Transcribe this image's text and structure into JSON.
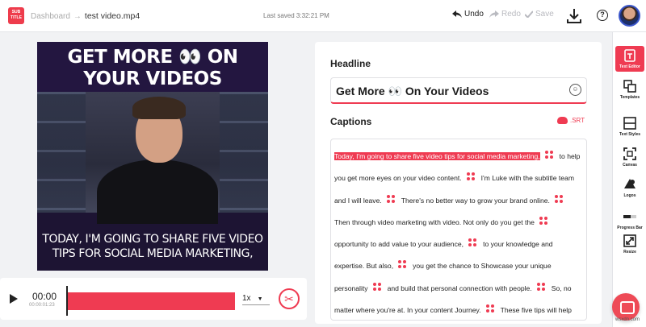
{
  "topbar": {
    "logo_text": "SUB TITLE",
    "breadcrumb_parent": "Dashboard",
    "breadcrumb_arrow": "→",
    "file_name": "test video.mp4",
    "last_saved": "Last saved 3:32:21 PM",
    "undo": "Undo",
    "redo": "Redo",
    "save": "Save",
    "help": "?"
  },
  "video": {
    "headline_line1": "GET MORE 👀 ON",
    "headline_line2": "YOUR VIDEOS",
    "caption_line1": "TODAY, I'M GOING TO SHARE FIVE VIDEO",
    "caption_line2": "TIPS FOR SOCIAL MEDIA MARKETING,"
  },
  "player": {
    "current_time": "00:00",
    "duration": "00:00:01:23",
    "speed": "1x",
    "progress": 0
  },
  "editor": {
    "headline_label": "Headline",
    "headline_value": "Get More 👀 On Your Videos",
    "captions_label": "Captions",
    "srt_label": ".SRT",
    "captions": [
      "Today, I'm going to share five video tips for social media marketing,",
      "to help you get more eyes on your video content.",
      "I'm Luke with the subtitle team and I will leave.",
      "There's no better way to grow your brand online.",
      "Then through video marketing with video. Not only do you get the",
      "opportunity to add value to your audience,",
      "to your knowledge and expertise. But also,",
      "you get the chance to Showcase your unique personality",
      "and build that personal connection with people.",
      "So, no matter where you're at. In your content Journey.",
      "These five tips will help"
    ]
  },
  "sidebar": {
    "items": [
      {
        "label": "Text Editor",
        "icon": "text-editor-icon"
      },
      {
        "label": "Templates",
        "icon": "templates-icon"
      },
      {
        "label": "Text Styles",
        "icon": "text-styles-icon"
      },
      {
        "label": "Canvas",
        "icon": "canvas-icon"
      },
      {
        "label": "Logos",
        "icon": "logos-icon"
      },
      {
        "label": "Progress Bar",
        "icon": "progress-bar-icon"
      },
      {
        "label": "Resize",
        "icon": "resize-icon"
      }
    ]
  },
  "watermark": "wsxdn.com",
  "colors": {
    "accent": "#ef3b52",
    "video_bg": "#231640"
  }
}
